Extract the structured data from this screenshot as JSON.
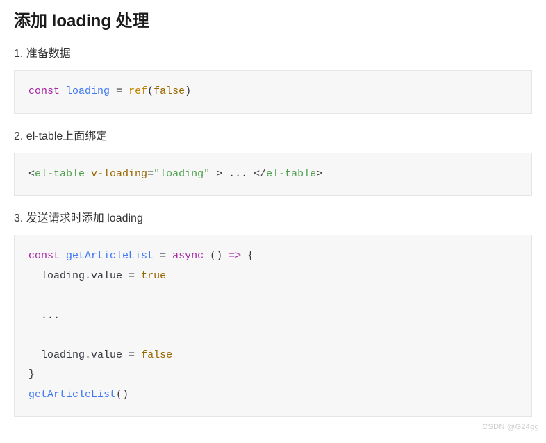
{
  "title": "添加 loading 处理",
  "steps": [
    {
      "num": "1.",
      "text": "准备数据"
    },
    {
      "num": "2.",
      "text": "el-table上面绑定"
    },
    {
      "num": "3.",
      "text": "发送请求时添加 loading"
    }
  ],
  "code1": {
    "kw_const": "const",
    "var_loading": "loading",
    "op_eq": " = ",
    "fn_ref": "ref",
    "lp": "(",
    "val_false": "false",
    "rp": ")"
  },
  "code2": {
    "lt1": "<",
    "tag_open": "el-table",
    "sp1": " ",
    "attr": "v-loading",
    "eq": "=",
    "str": "\"loading\"",
    "sp2": " ",
    "gt1": ">",
    "mid": " ... ",
    "lt2": "</",
    "tag_close": "el-table",
    "gt2": ">"
  },
  "code3": {
    "l1_kw": "const",
    "l1_sp1": " ",
    "l1_var": "getArticleList",
    "l1_eq": " = ",
    "l1_async": "async",
    "l1_parens": " () ",
    "l1_arrow": "=>",
    "l1_brace": " {",
    "l2_indent": "  ",
    "l2_obj": "loading",
    "l2_dot": ".",
    "l2_prop": "value",
    "l2_eq": " = ",
    "l2_val": "true",
    "l4_indent": "  ",
    "l4_dots": "...",
    "l6_indent": "  ",
    "l6_obj": "loading",
    "l6_dot": ".",
    "l6_prop": "value",
    "l6_eq": " = ",
    "l6_val": "false",
    "l7_brace": "}",
    "l8_call": "getArticleList",
    "l8_parens": "()"
  },
  "watermark": "CSDN @G24gg"
}
